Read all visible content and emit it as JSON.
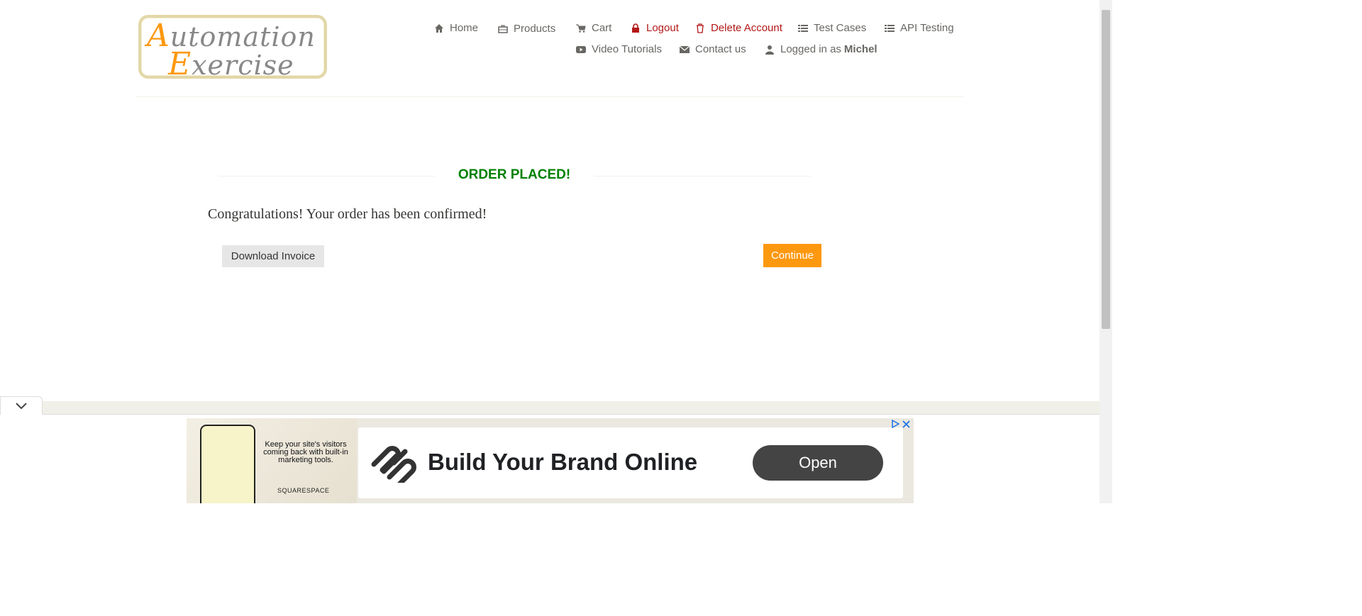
{
  "logo": {
    "line1_cap": "A",
    "line1_rest": "utomation",
    "line2_cap": "E",
    "line2_rest": "xercise"
  },
  "nav": {
    "home": "Home",
    "products": "Products",
    "cart": "Cart",
    "logout": "Logout",
    "delete_account": "Delete Account",
    "test_cases": "Test Cases",
    "api_testing": "API Testing",
    "video_tutorials": "Video Tutorials",
    "contact_us": "Contact us",
    "logged_in_prefix": "Logged in as",
    "logged_in_user": "Michel"
  },
  "order": {
    "title": "ORDER PLACED!",
    "message": "Congratulations! Your order has been confirmed!",
    "download_invoice": "Download Invoice",
    "continue": "Continue"
  },
  "ad": {
    "image_text": "Keep your site's visitors coming back with built-in marketing tools.",
    "brand": "SQUARESPACE",
    "headline": "Build Your Brand Online",
    "cta": "Open"
  },
  "colors": {
    "accent": "#fe980f",
    "success": "#008000",
    "danger": "#b41717"
  }
}
